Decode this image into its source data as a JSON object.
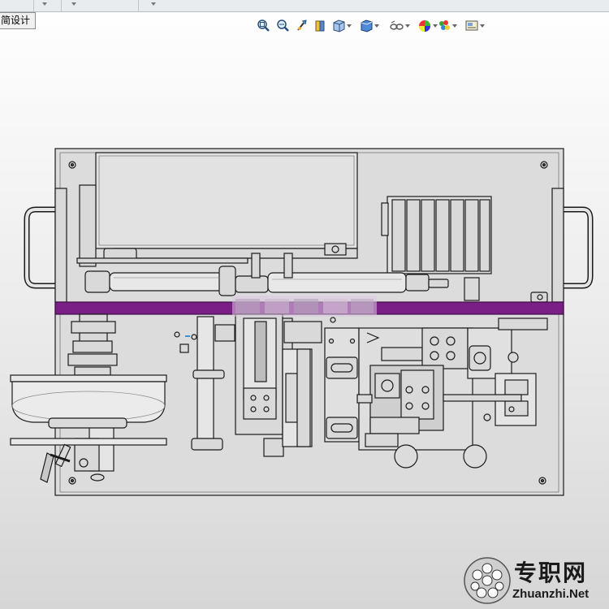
{
  "window": {
    "tab_label": "简设计"
  },
  "heads_up_toolbar": {
    "tools": [
      {
        "icon": "zoom-to-fit-icon"
      },
      {
        "icon": "zoom-to-area-icon"
      },
      {
        "icon": "previous-view-icon"
      },
      {
        "icon": "section-view-icon"
      },
      {
        "icon": "view-orientation-icon",
        "dropdown": true
      },
      {
        "icon": "display-style-icon",
        "dropdown": true
      },
      {
        "icon": "hide-show-items-icon",
        "dropdown": true
      },
      {
        "icon": "edit-appearance-icon",
        "dropdown": true
      },
      {
        "icon": "apply-scene-icon",
        "dropdown": true
      },
      {
        "icon": "view-settings-icon",
        "dropdown": true
      }
    ]
  },
  "model": {
    "type": "machine-assembly-top-view",
    "highlight_color": "#7a1f86",
    "edge_color": "#1a1a1a",
    "part_fill": "#d9d9d9"
  },
  "watermark": {
    "chinese_text": "专职网",
    "url_text": "Zhuanzhi.Net",
    "logo_icon": "globe-icon"
  }
}
